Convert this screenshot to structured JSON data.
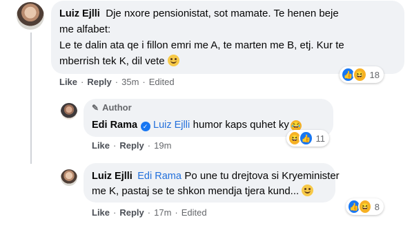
{
  "comments": [
    {
      "author": "Luiz Ejlli",
      "body_lines": [
        "Dje nxore pensionistat, sot mamate. Te henen beje",
        "me alfabet:",
        "Le te dalin ata qe i fillon emri me A, te marten me B, etj. Kur te",
        "mberrish tek K, dil vete"
      ],
      "actions": {
        "like": "Like",
        "reply": "Reply",
        "time": "35m",
        "edited": "Edited"
      },
      "reactions": {
        "count": "18",
        "types": [
          "like",
          "haha"
        ]
      }
    },
    {
      "author_badge": "Author",
      "author": "Edi Rama",
      "mention": "Luiz Ejlli",
      "body": "humor kaps quhet ky",
      "actions": {
        "like": "Like",
        "reply": "Reply",
        "time": "19m"
      },
      "reactions": {
        "count": "11",
        "types": [
          "haha",
          "like"
        ]
      }
    },
    {
      "author": "Luiz Ejlli",
      "mention": "Edi Rama",
      "body_lines": [
        "Po une tu drejtova si Kryeminister",
        "me K, pastaj se te shkon mendja tjera kund..."
      ],
      "actions": {
        "like": "Like",
        "reply": "Reply",
        "time": "17m",
        "edited": "Edited"
      },
      "reactions": {
        "count": "8",
        "types": [
          "like",
          "haha"
        ]
      }
    }
  ],
  "icons": {
    "verified": "verified-badge-icon",
    "pencil": "pencil-icon",
    "like": "like-icon",
    "haha": "haha-icon",
    "smile": "smile-emoji-icon"
  }
}
